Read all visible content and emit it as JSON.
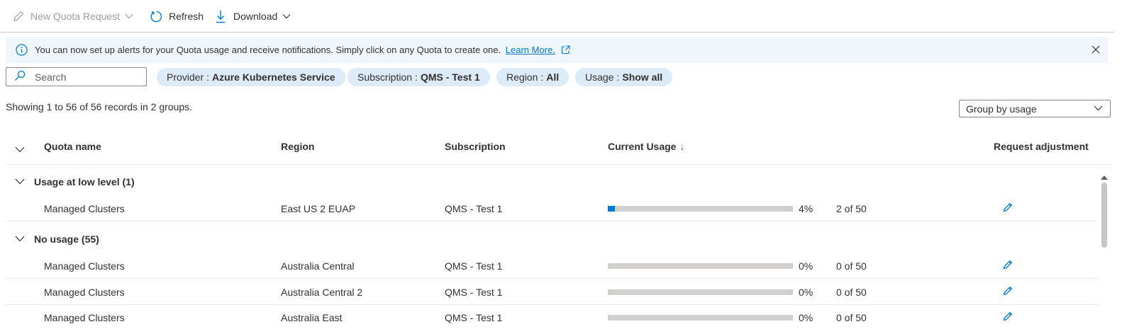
{
  "toolbar": {
    "new_request": "New Quota Request",
    "refresh": "Refresh",
    "download": "Download"
  },
  "banner": {
    "message": "You can now set up alerts for your Quota usage and receive notifications. Simply click on any Quota to create one.",
    "link": "Learn More."
  },
  "filters": {
    "search_placeholder": "Search",
    "provider_key": "Provider",
    "provider_value": "Azure Kubernetes Service",
    "subscription_key": "Subscription",
    "subscription_value": "QMS - Test 1",
    "region_key": "Region",
    "region_value": "All",
    "usage_key": "Usage",
    "usage_value": "Show all"
  },
  "summary": "Showing 1 to 56 of 56 records in 2 groups.",
  "groupby": {
    "selected": "Group by usage"
  },
  "columns": {
    "quota_name": "Quota name",
    "region": "Region",
    "subscription": "Subscription",
    "current_usage": "Current Usage",
    "sort_arrow": "↓",
    "request_adjustment": "Request adjustment"
  },
  "groups": [
    {
      "label": "Usage at low level (1)"
    },
    {
      "label": "No usage (55)"
    }
  ],
  "rows": [
    {
      "name": "Managed Clusters",
      "region": "East US 2 EUAP",
      "subscription": "QMS - Test 1",
      "usage_fraction": 0.04,
      "percent": "4%",
      "of": "2 of 50"
    },
    {
      "name": "Managed Clusters",
      "region": "Australia Central",
      "subscription": "QMS - Test 1",
      "usage_fraction": 0,
      "percent": "0%",
      "of": "0 of 50"
    },
    {
      "name": "Managed Clusters",
      "region": "Australia Central 2",
      "subscription": "QMS - Test 1",
      "usage_fraction": 0,
      "percent": "0%",
      "of": "0 of 50"
    },
    {
      "name": "Managed Clusters",
      "region": "Australia East",
      "subscription": "QMS - Test 1",
      "usage_fraction": 0,
      "percent": "0%",
      "of": "0 of 50"
    }
  ],
  "colors": {
    "accent": "#0078d4",
    "banner_bg": "#eff6fc",
    "pill_bg": "#dcebf7",
    "bar_track": "#d2d0ce"
  },
  "icons": [
    "pencil-icon",
    "refresh-icon",
    "download-icon",
    "chevron-down-icon",
    "info-icon",
    "external-link-icon",
    "close-icon",
    "search-icon",
    "edit-icon",
    "scroll-up-icon"
  ]
}
